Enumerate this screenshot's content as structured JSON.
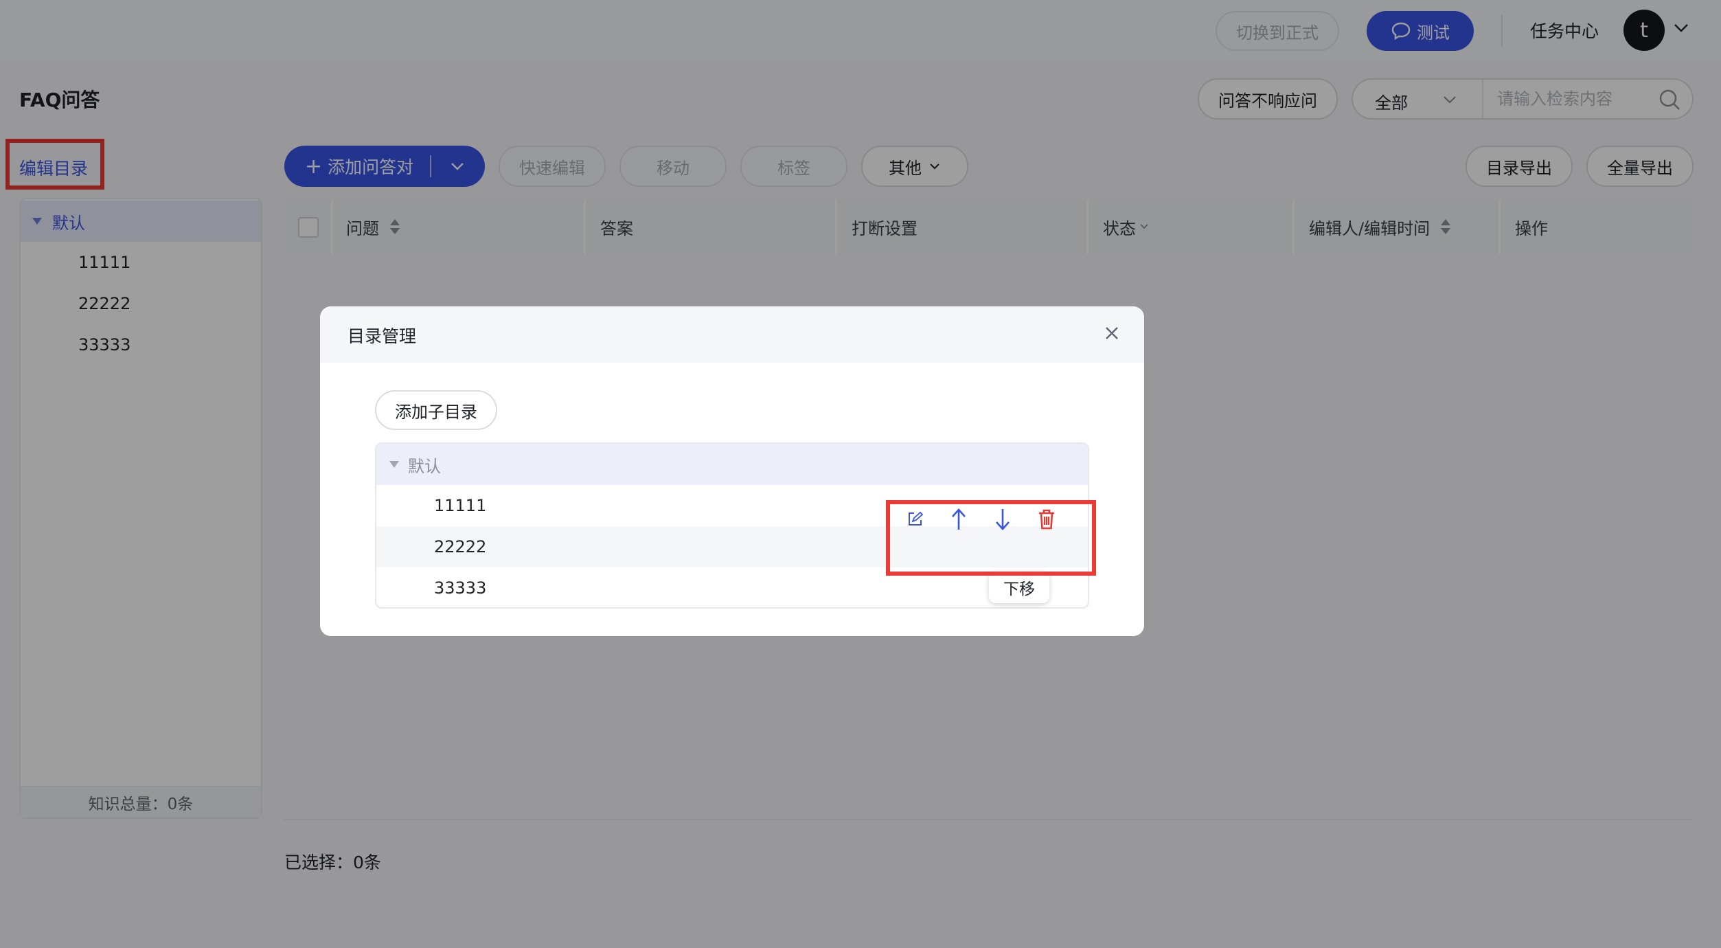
{
  "topbar": {
    "switch_label": "切换到正式",
    "test_label": "测试",
    "task_center": "任务中心",
    "avatar_letter": "t"
  },
  "header": {
    "title": "FAQ问答",
    "no_response_label": "问答不响应问",
    "filter_value": "全部",
    "search_placeholder": "请输入检索内容"
  },
  "toolbar": {
    "edit_directory": "编辑目录",
    "add_qa": "添加问答对",
    "quick_edit": "快速编辑",
    "move": "移动",
    "tag": "标签",
    "other": "其他",
    "dir_export": "目录导出",
    "full_export": "全量导出"
  },
  "sidebar": {
    "root": "默认",
    "items": [
      {
        "label": "11111"
      },
      {
        "label": "22222"
      },
      {
        "label": "33333"
      }
    ],
    "footer": "知识总量：0条"
  },
  "table": {
    "columns": [
      "问题",
      "答案",
      "打断设置",
      "状态",
      "编辑人/编辑时间",
      "操作"
    ]
  },
  "footer": {
    "selected": "已选择：0条"
  },
  "modal": {
    "title": "目录管理",
    "add_sub_label": "添加子目录",
    "root": "默认",
    "items": [
      {
        "label": "11111"
      },
      {
        "label": "22222"
      },
      {
        "label": "33333"
      }
    ],
    "tooltip": "下移"
  },
  "colors": {
    "primary": "#3955e6",
    "danger": "#e23b36",
    "highlight_box": "#ea3b36"
  }
}
